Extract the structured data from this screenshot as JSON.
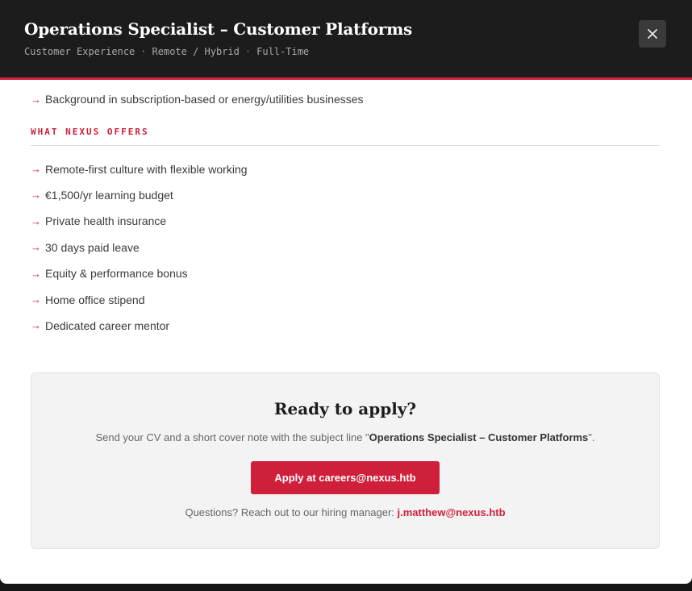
{
  "modal": {
    "title": "Operations Specialist – Customer Platforms",
    "meta": [
      "Customer Experience",
      "Remote / Hybrid",
      "Full-Time"
    ],
    "meta_separator": "·",
    "close_icon": "close-icon"
  },
  "requirements": {
    "bullets": [
      "Background in subscription-based or energy/utilities businesses"
    ]
  },
  "offers": {
    "heading": "WHAT NEXUS OFFERS",
    "bullets": [
      "Remote-first culture with flexible working",
      "€1,500/yr learning budget",
      "Private health insurance",
      "30 days paid leave",
      "Equity & performance bonus",
      "Home office stipend",
      "Dedicated career mentor"
    ]
  },
  "bullet_glyph": "→",
  "apply": {
    "title": "Ready to apply?",
    "desc_prefix": "Send your CV and a short cover note with the subject line \"",
    "desc_subject": "Operations Specialist – Customer Platforms",
    "desc_suffix": "\".",
    "button_label": "Apply at careers@nexus.htb",
    "contact_prefix": "Questions? Reach out to our hiring manager: ",
    "contact_email": "j.matthew@nexus.htb"
  },
  "colors": {
    "accent": "#cf1f3a",
    "header_bg": "#1c1c1c",
    "card_bg": "#f3f3f3"
  }
}
